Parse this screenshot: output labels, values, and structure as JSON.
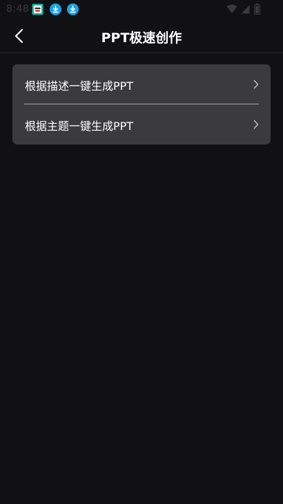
{
  "status_bar": {
    "time": "8:48",
    "notification_icons": [
      "app-notification-icon",
      "download-icon",
      "download-icon"
    ],
    "right_icons": [
      "wifi-icon",
      "signal-icon",
      "battery-icon"
    ]
  },
  "nav": {
    "title": "PPT极速创作",
    "back_icon": "chevron-left-icon"
  },
  "menu": {
    "items": [
      {
        "label": "根据描述一键生成PPT",
        "icon": "chevron-right-icon"
      },
      {
        "label": "根据主题一键生成PPT",
        "icon": "chevron-right-icon"
      }
    ]
  },
  "colors": {
    "background": "#111113",
    "card": "#3b3b3d",
    "divider": "#a9a9ab",
    "download_badge": "#1aa3e8",
    "text": "#ffffff"
  }
}
